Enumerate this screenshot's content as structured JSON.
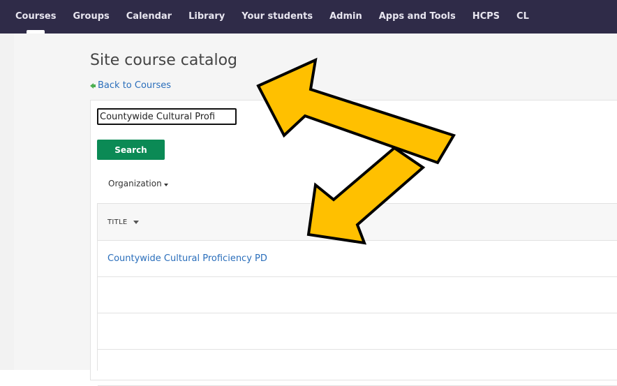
{
  "nav": {
    "items": [
      {
        "label": "Courses",
        "active": true
      },
      {
        "label": "Groups",
        "active": false
      },
      {
        "label": "Calendar",
        "active": false
      },
      {
        "label": "Library",
        "active": false
      },
      {
        "label": "Your students",
        "active": false
      },
      {
        "label": "Admin",
        "active": false
      },
      {
        "label": "Apps and Tools",
        "active": false
      },
      {
        "label": "HCPS",
        "active": false
      },
      {
        "label": "CL",
        "active": false
      }
    ]
  },
  "page": {
    "title": "Site course catalog",
    "back_link": "Back to Courses"
  },
  "search": {
    "value": "Countywide Cultural Profi",
    "button_label": "Search"
  },
  "filter": {
    "organization_label": "Organization"
  },
  "table": {
    "header_title": "TITLE",
    "rows": [
      {
        "title": "Countywide Cultural Proficiency PD"
      },
      {
        "title": ""
      },
      {
        "title": ""
      },
      {
        "title": ""
      }
    ]
  },
  "icons": {
    "back": "arrow-left-icon",
    "org_caret": "caret-down-icon",
    "sort": "sort-down-icon",
    "annotation": "callout-arrow-icon"
  },
  "colors": {
    "nav_bg": "#2f2b48",
    "accent_green": "#0b8a55",
    "link_blue": "#2a6ebb",
    "annotation_yellow": "#ffc000"
  }
}
